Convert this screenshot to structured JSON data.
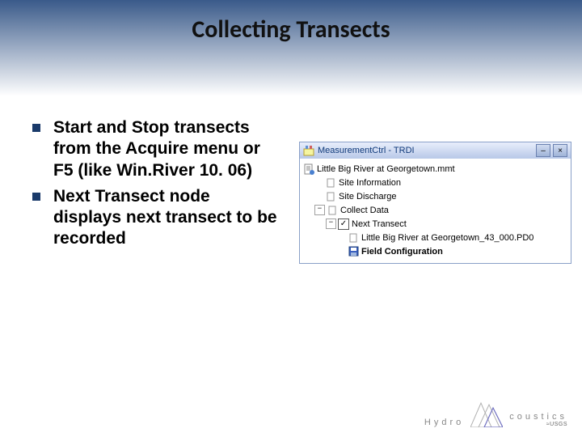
{
  "title": "Collecting Transects",
  "bullets": [
    "Start and Stop transects from the Acquire menu or F5 (like Win.River 10. 06)",
    "Next Transect node displays next transect to be recorded"
  ],
  "window": {
    "title": "MeasurementCtrl - TRDI",
    "minimize": "–",
    "close": "×"
  },
  "tree": {
    "root": "Little Big River at Georgetown.mmt",
    "site_info": "Site Information",
    "site_discharge": "Site Discharge",
    "collect_data": "Collect Data",
    "next_transect": "Next Transect",
    "check": "✓",
    "file": "Little Big River at Georgetown_43_000.PD0",
    "field_config": "Field Configuration",
    "plus": "+",
    "minus": "−"
  },
  "footer": {
    "brand_left": "Hydro",
    "brand_right": "coustics",
    "usgs": "≈USGS"
  }
}
